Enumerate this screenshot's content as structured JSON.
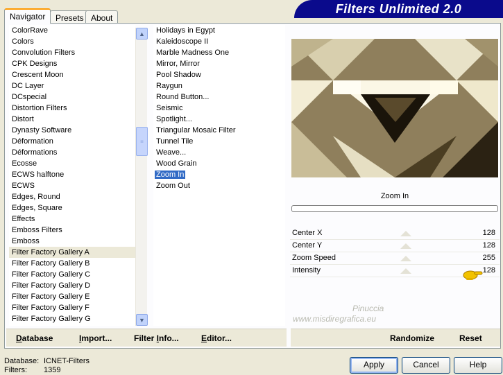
{
  "tabs": [
    "Navigator",
    "Presets",
    "About"
  ],
  "banner": {
    "title": "Filters Unlimited 2.0"
  },
  "categories": {
    "items": [
      "ColorRave",
      "Colors",
      "Convolution Filters",
      "CPK Designs",
      "Crescent Moon",
      "DC Layer",
      "DCspecial",
      "Distortion Filters",
      "Distort",
      "Dynasty Software",
      "Déformation",
      "Déformations",
      "Ecosse",
      "ECWS halftone",
      "ECWS",
      "Edges, Round",
      "Edges, Square",
      "Effects",
      "Emboss Filters",
      "Emboss",
      "Filter Factory Gallery A",
      "Filter Factory Gallery B",
      "Filter Factory Gallery C",
      "Filter Factory Gallery D",
      "Filter Factory Gallery E",
      "Filter Factory Gallery F",
      "Filter Factory Gallery G"
    ],
    "highlighted": "Filter Factory Gallery A"
  },
  "filters": {
    "items": [
      "Holidays in Egypt",
      "Kaleidoscope II",
      "Marble Madness One",
      "Mirror, Mirror",
      "Pool Shadow",
      "Raygun",
      "Round Button...",
      "Seismic",
      "Spotlight...",
      "Triangular Mosaic Filter",
      "Tunnel Tile",
      "Weave...",
      "Wood Grain",
      "Zoom In",
      "Zoom Out"
    ],
    "selected": "Zoom In"
  },
  "preview": {
    "filter_name": "Zoom In"
  },
  "controls": [
    {
      "label": "Center X",
      "value": "128"
    },
    {
      "label": "Center Y",
      "value": "128"
    },
    {
      "label": "Zoom Speed",
      "value": "255"
    },
    {
      "label": "Intensity",
      "value": "128"
    }
  ],
  "watermark": [
    "Pinuccia",
    "www.misdiregrafica.eu"
  ],
  "left_actions": [
    {
      "pre": "",
      "u": "D",
      "post": "atabase"
    },
    {
      "pre": "",
      "u": "I",
      "post": "mport..."
    },
    {
      "pre": "Filter ",
      "u": "I",
      "post": "nfo..."
    },
    {
      "pre": "",
      "u": "E",
      "post": "ditor..."
    }
  ],
  "right_actions": {
    "randomize": "Randomize",
    "reset": "Reset"
  },
  "status": {
    "database_label": "Database:",
    "database_value": "ICNET-Filters",
    "filters_label": "Filters:",
    "filters_value": "1359"
  },
  "buttons": {
    "apply": "Apply",
    "cancel": "Cancel",
    "help": "Help"
  },
  "colors": {
    "banner": "#0a0a8c",
    "selection": "#316ac5",
    "window": "#ece9d8"
  }
}
